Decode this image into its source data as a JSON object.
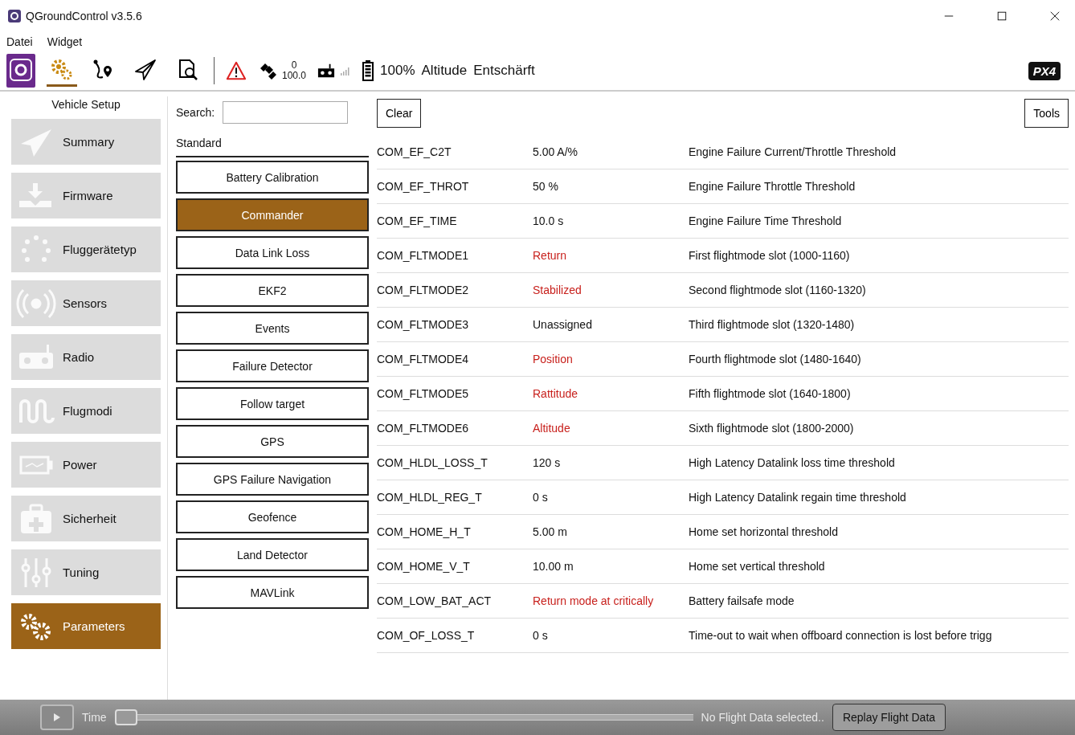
{
  "window": {
    "title": "QGroundControl v3.5.6"
  },
  "menu": [
    {
      "label": "Datei"
    },
    {
      "label": "Widget"
    }
  ],
  "toolbar": {
    "views": [
      {
        "selected": false
      },
      {
        "selected": true
      },
      {
        "selected": false
      },
      {
        "selected": false
      },
      {
        "selected": false
      }
    ],
    "gps_count": "0",
    "gps_hdop": "100.0",
    "battery": "100%",
    "flight_mode": "Altitude",
    "armed_state": "Entschärft",
    "logo": "PX4"
  },
  "sidebar": {
    "title": "Vehicle Setup",
    "items": [
      {
        "label": "Summary",
        "selected": false
      },
      {
        "label": "Firmware",
        "selected": false
      },
      {
        "label": "Fluggerätetyp",
        "selected": false
      },
      {
        "label": "Sensors",
        "selected": false
      },
      {
        "label": "Radio",
        "selected": false
      },
      {
        "label": "Flugmodi",
        "selected": false
      },
      {
        "label": "Power",
        "selected": false
      },
      {
        "label": "Sicherheit",
        "selected": false
      },
      {
        "label": "Tuning",
        "selected": false
      },
      {
        "label": "Parameters",
        "selected": true
      }
    ]
  },
  "search": {
    "label": "Search:"
  },
  "buttons": {
    "clear": "Clear",
    "tools": "Tools"
  },
  "groups": {
    "category": "Standard",
    "items": [
      {
        "label": "Battery Calibration",
        "selected": false
      },
      {
        "label": "Commander",
        "selected": true
      },
      {
        "label": "Data Link Loss",
        "selected": false
      },
      {
        "label": "EKF2",
        "selected": false
      },
      {
        "label": "Events",
        "selected": false
      },
      {
        "label": "Failure Detector",
        "selected": false
      },
      {
        "label": "Follow target",
        "selected": false
      },
      {
        "label": "GPS",
        "selected": false
      },
      {
        "label": "GPS Failure Navigation",
        "selected": false
      },
      {
        "label": "Geofence",
        "selected": false
      },
      {
        "label": "Land Detector",
        "selected": false
      },
      {
        "label": "MAVLink",
        "selected": false
      }
    ]
  },
  "parameters": [
    {
      "name": "COM_EF_C2T",
      "value": "5.00 A/%",
      "description": "Engine Failure Current/Throttle Threshold",
      "non_default": false
    },
    {
      "name": "COM_EF_THROT",
      "value": "50 %",
      "description": "Engine Failure Throttle Threshold",
      "non_default": false
    },
    {
      "name": "COM_EF_TIME",
      "value": "10.0 s",
      "description": "Engine Failure Time Threshold",
      "non_default": false
    },
    {
      "name": "COM_FLTMODE1",
      "value": "Return",
      "description": "First flightmode slot (1000-1160)",
      "non_default": true
    },
    {
      "name": "COM_FLTMODE2",
      "value": "Stabilized",
      "description": "Second flightmode slot (1160-1320)",
      "non_default": true
    },
    {
      "name": "COM_FLTMODE3",
      "value": "Unassigned",
      "description": "Third flightmode slot (1320-1480)",
      "non_default": false
    },
    {
      "name": "COM_FLTMODE4",
      "value": "Position",
      "description": "Fourth flightmode slot (1480-1640)",
      "non_default": true
    },
    {
      "name": "COM_FLTMODE5",
      "value": "Rattitude",
      "description": "Fifth flightmode slot (1640-1800)",
      "non_default": true
    },
    {
      "name": "COM_FLTMODE6",
      "value": "Altitude",
      "description": "Sixth flightmode slot (1800-2000)",
      "non_default": true
    },
    {
      "name": "COM_HLDL_LOSS_T",
      "value": "120 s",
      "description": "High Latency Datalink loss time threshold",
      "non_default": false
    },
    {
      "name": "COM_HLDL_REG_T",
      "value": "0 s",
      "description": "High Latency Datalink regain time threshold",
      "non_default": false
    },
    {
      "name": "COM_HOME_H_T",
      "value": "5.00 m",
      "description": "Home set horizontal threshold",
      "non_default": false
    },
    {
      "name": "COM_HOME_V_T",
      "value": "10.00 m",
      "description": "Home set vertical threshold",
      "non_default": false
    },
    {
      "name": "COM_LOW_BAT_ACT",
      "value": "Return mode at critically",
      "description": "Battery failsafe mode",
      "non_default": true
    },
    {
      "name": "COM_OF_LOSS_T",
      "value": "0 s",
      "description": "Time-out to wait when offboard connection is lost before trigg",
      "non_default": false
    }
  ],
  "replay": {
    "time_label": "Time",
    "level": 0,
    "status": "No Flight Data selected..",
    "button": "Replay Flight Data"
  }
}
